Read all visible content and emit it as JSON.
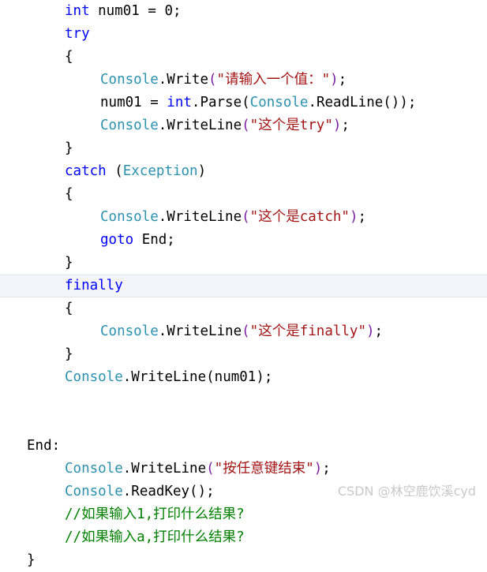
{
  "editor": {
    "language": "csharp",
    "background_color": "#ffffff",
    "current_line_highlight_color": "#f4f4fb",
    "current_line_border_color": "#e3e3ef",
    "font_size_px": 17.5,
    "line_height_px": 29
  },
  "colors": {
    "keyword": "#0000ff",
    "type": "#2b91af",
    "string": "#a31515",
    "comment": "#008000",
    "plain": "#000000",
    "bracket_level_1": "#7b1fa2",
    "watermark": "#c9c9c9"
  },
  "watermark": {
    "text": "CSDN @林空鹿饮溪cyd"
  },
  "lines": [
    {
      "index": 0,
      "indent": 1,
      "current": false,
      "tokens": [
        {
          "t": "int",
          "c": "keyword"
        },
        {
          "t": " num01 = ",
          "c": "plain"
        },
        {
          "t": "0",
          "c": "number"
        },
        {
          "t": ";",
          "c": "plain"
        }
      ]
    },
    {
      "index": 1,
      "indent": 1,
      "current": false,
      "tokens": [
        {
          "t": "try",
          "c": "keyword"
        }
      ]
    },
    {
      "index": 2,
      "indent": 1,
      "current": false,
      "tokens": [
        {
          "t": "{",
          "c": "plain"
        }
      ]
    },
    {
      "index": 3,
      "indent": 2,
      "current": false,
      "tokens": [
        {
          "t": "Console",
          "c": "class"
        },
        {
          "t": ".Write",
          "c": "plain"
        },
        {
          "t": "(",
          "c": "bracket1"
        },
        {
          "t": "\"请输入一个值：\"",
          "c": "string"
        },
        {
          "t": ")",
          "c": "bracket1"
        },
        {
          "t": ";",
          "c": "plain"
        }
      ]
    },
    {
      "index": 4,
      "indent": 2,
      "current": false,
      "tokens": [
        {
          "t": "num01 = ",
          "c": "plain"
        },
        {
          "t": "int",
          "c": "keyword"
        },
        {
          "t": ".Parse(",
          "c": "plain"
        },
        {
          "t": "Console",
          "c": "class"
        },
        {
          "t": ".ReadLine());",
          "c": "plain"
        }
      ]
    },
    {
      "index": 5,
      "indent": 2,
      "current": false,
      "tokens": [
        {
          "t": "Console",
          "c": "class"
        },
        {
          "t": ".WriteLine",
          "c": "plain"
        },
        {
          "t": "(",
          "c": "bracket1"
        },
        {
          "t": "\"这个是try\"",
          "c": "string"
        },
        {
          "t": ")",
          "c": "bracket1"
        },
        {
          "t": ";",
          "c": "plain"
        }
      ]
    },
    {
      "index": 6,
      "indent": 1,
      "current": false,
      "tokens": [
        {
          "t": "}",
          "c": "plain"
        }
      ]
    },
    {
      "index": 7,
      "indent": 1,
      "current": false,
      "tokens": [
        {
          "t": "catch",
          "c": "keyword"
        },
        {
          "t": " (",
          "c": "plain"
        },
        {
          "t": "Exception",
          "c": "type"
        },
        {
          "t": ")",
          "c": "plain"
        }
      ]
    },
    {
      "index": 8,
      "indent": 1,
      "current": false,
      "tokens": [
        {
          "t": "{",
          "c": "plain"
        }
      ]
    },
    {
      "index": 9,
      "indent": 2,
      "current": false,
      "tokens": [
        {
          "t": "Console",
          "c": "class"
        },
        {
          "t": ".WriteLine",
          "c": "plain"
        },
        {
          "t": "(",
          "c": "bracket1"
        },
        {
          "t": "\"这个是catch\"",
          "c": "string"
        },
        {
          "t": ")",
          "c": "bracket1"
        },
        {
          "t": ";",
          "c": "plain"
        }
      ]
    },
    {
      "index": 10,
      "indent": 2,
      "current": false,
      "tokens": [
        {
          "t": "goto",
          "c": "keyword"
        },
        {
          "t": " End;",
          "c": "plain"
        }
      ]
    },
    {
      "index": 11,
      "indent": 1,
      "current": false,
      "tokens": [
        {
          "t": "}",
          "c": "plain"
        }
      ]
    },
    {
      "index": 12,
      "indent": 1,
      "current": true,
      "tokens": [
        {
          "t": "finally",
          "c": "keyword"
        }
      ]
    },
    {
      "index": 13,
      "indent": 1,
      "current": false,
      "tokens": [
        {
          "t": "{",
          "c": "plain"
        }
      ]
    },
    {
      "index": 14,
      "indent": 2,
      "current": false,
      "tokens": [
        {
          "t": "Console",
          "c": "class"
        },
        {
          "t": ".WriteLine",
          "c": "plain"
        },
        {
          "t": "(",
          "c": "bracket1"
        },
        {
          "t": "\"这个是finally\"",
          "c": "string"
        },
        {
          "t": ")",
          "c": "bracket1"
        },
        {
          "t": ";",
          "c": "plain"
        }
      ]
    },
    {
      "index": 15,
      "indent": 1,
      "current": false,
      "tokens": [
        {
          "t": "}",
          "c": "plain"
        }
      ]
    },
    {
      "index": 16,
      "indent": 1,
      "current": false,
      "tokens": [
        {
          "t": "Console",
          "c": "class"
        },
        {
          "t": ".WriteLine(num01);",
          "c": "plain"
        }
      ]
    },
    {
      "index": 17,
      "indent": 1,
      "current": false,
      "tokens": []
    },
    {
      "index": 18,
      "indent": 1,
      "current": false,
      "tokens": []
    },
    {
      "index": 19,
      "indent": 0,
      "current": false,
      "tokens": [
        {
          "t": "End:",
          "c": "plain"
        }
      ]
    },
    {
      "index": 20,
      "indent": 1,
      "current": false,
      "tokens": [
        {
          "t": "Console",
          "c": "class"
        },
        {
          "t": ".WriteLine",
          "c": "plain"
        },
        {
          "t": "(",
          "c": "bracket1"
        },
        {
          "t": "\"按任意键结束\"",
          "c": "string"
        },
        {
          "t": ")",
          "c": "bracket1"
        },
        {
          "t": ";",
          "c": "plain"
        }
      ]
    },
    {
      "index": 21,
      "indent": 1,
      "current": false,
      "tokens": [
        {
          "t": "Console",
          "c": "class"
        },
        {
          "t": ".ReadKey();",
          "c": "plain"
        }
      ]
    },
    {
      "index": 22,
      "indent": 1,
      "current": false,
      "tokens": [
        {
          "t": "//如果输入1,打印什么结果?",
          "c": "comment"
        }
      ]
    },
    {
      "index": 23,
      "indent": 1,
      "current": false,
      "tokens": [
        {
          "t": "//如果输入a,打印什么结果?",
          "c": "comment"
        }
      ]
    },
    {
      "index": 24,
      "indent": 0,
      "current": false,
      "tokens": [
        {
          "t": "}",
          "c": "plain"
        }
      ]
    }
  ]
}
